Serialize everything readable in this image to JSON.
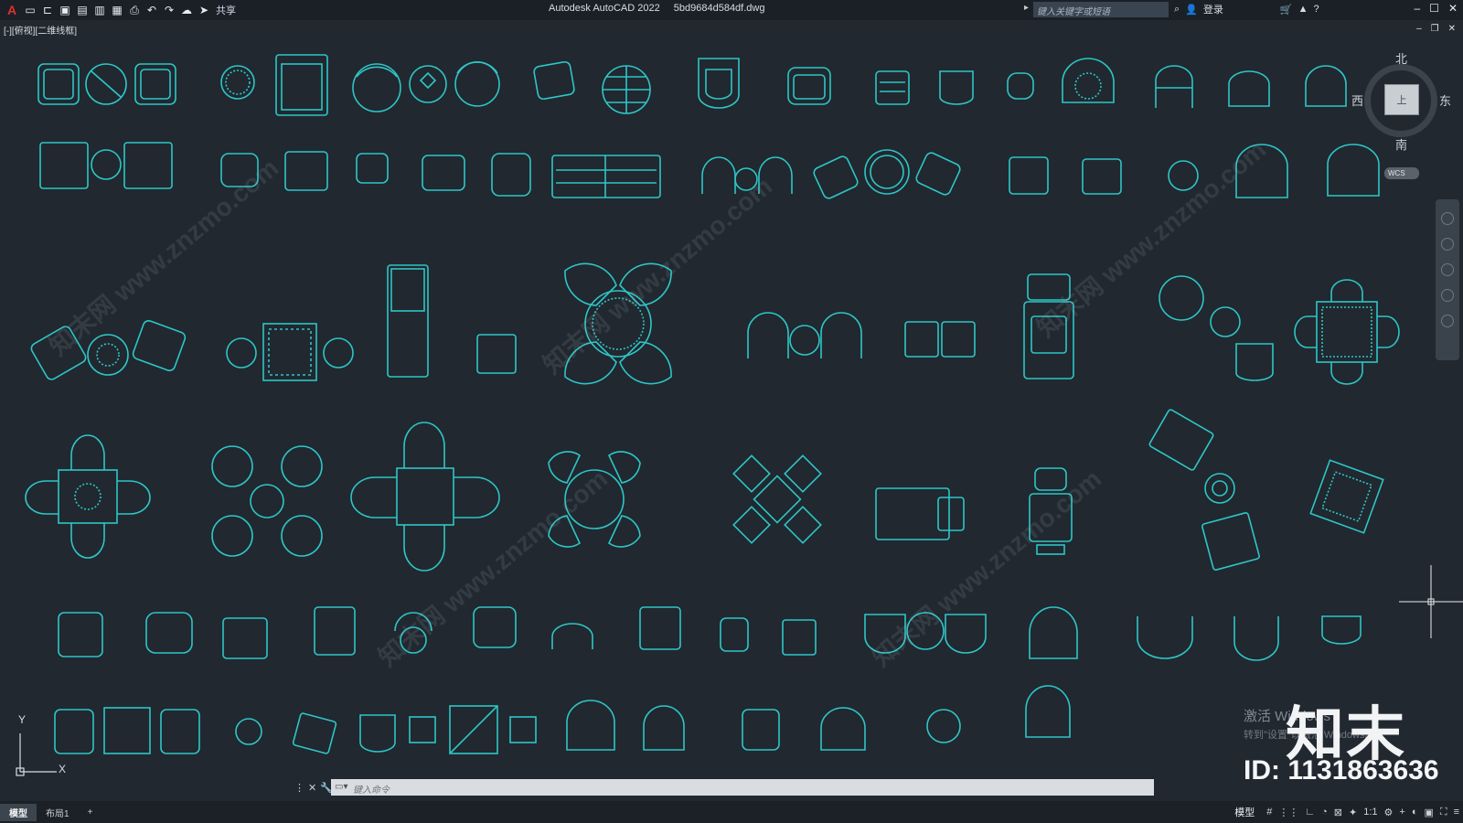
{
  "titlebar": {
    "app_name": "Autodesk AutoCAD 2022",
    "file_name": "5bd9684d584df.dwg",
    "share_label": "共享",
    "search_placeholder": "键入关键字或短语",
    "login_label": "登录",
    "icons": [
      "autocad-logo-icon",
      "new-icon",
      "open-icon",
      "save-icon",
      "saveas-icon",
      "plot-icon",
      "publish-icon",
      "print-icon",
      "undo-icon",
      "redo-icon",
      "cloud-icon",
      "share-icon"
    ]
  },
  "viewport": {
    "view_label": "[-][俯视][二维线框]",
    "compass": {
      "north": "北",
      "south": "南",
      "west": "西",
      "east": "东",
      "cube_face": "上"
    },
    "wcs_label": "WCS",
    "ucs": {
      "x": "X",
      "y": "Y"
    }
  },
  "watermark": {
    "text": "知末网 www.znzmo.com",
    "activate_line1": "激活 Windows",
    "activate_line2": "转到\"设置\"以激活 Windows。",
    "logo": "知末",
    "id": "ID: 1131863636"
  },
  "command": {
    "placeholder": "键入命令"
  },
  "status": {
    "tabs": [
      "模型",
      "布局1"
    ],
    "add_tab": "+",
    "model_label": "模型",
    "scale": "1:1"
  },
  "colors": {
    "background": "#212830",
    "line": "#2ec6c6"
  }
}
